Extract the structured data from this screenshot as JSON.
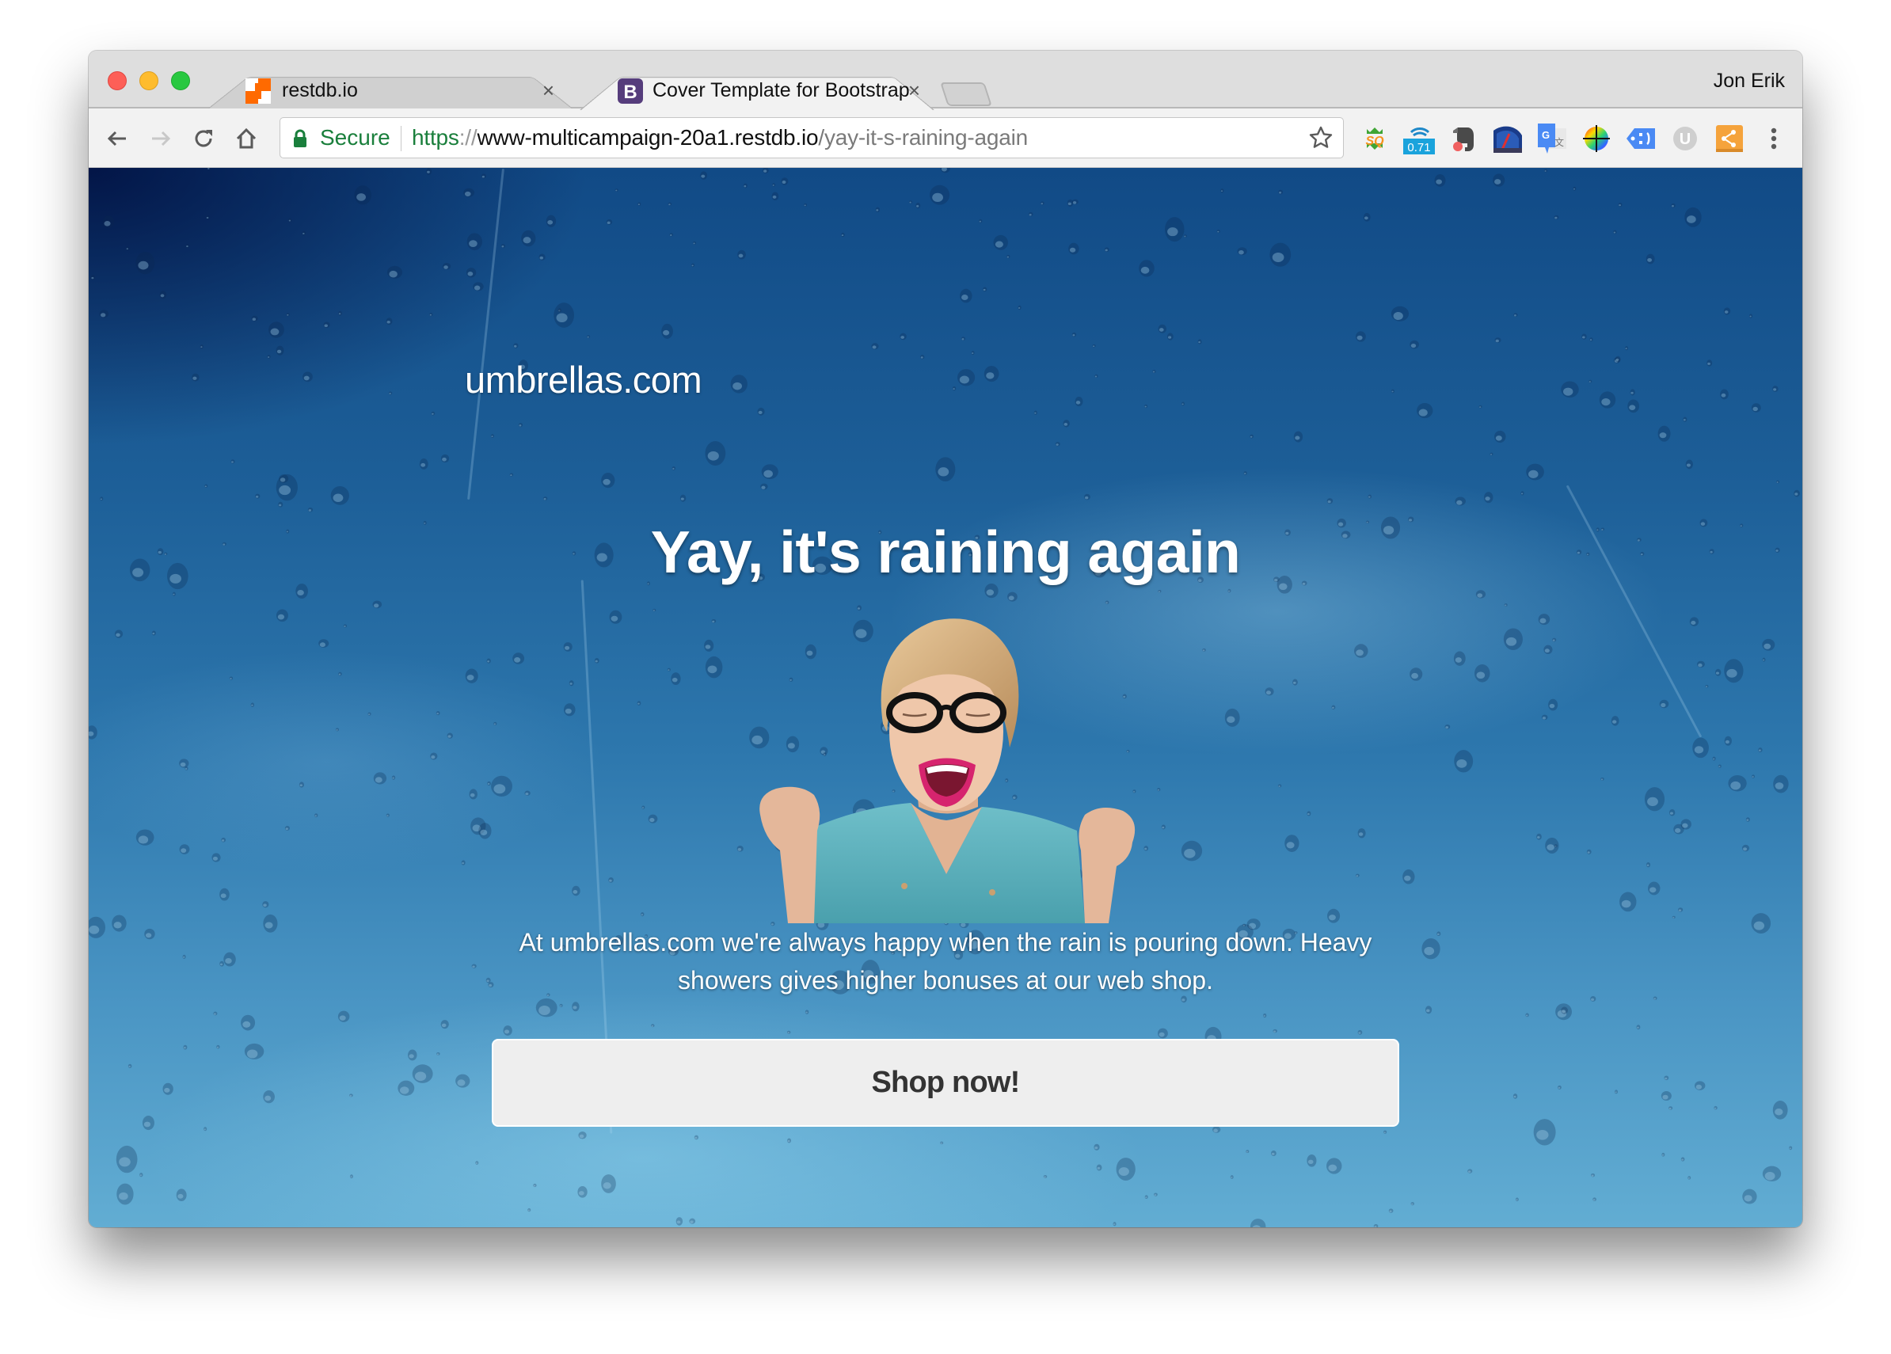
{
  "browser": {
    "tabs": [
      {
        "title": "restdb.io",
        "favicon": "restdb-icon",
        "active": false,
        "close_label": "×"
      },
      {
        "title": "Cover Template for Bootstrap",
        "favicon": "bootstrap-icon",
        "active": true,
        "close_label": "×"
      }
    ],
    "profile_name": "Jon Erik",
    "omnibox": {
      "security_label": "Secure",
      "url_scheme": "https",
      "url_separator": "://",
      "url_host": "www-multicampaign-20a1.restdb.io",
      "url_path": "/yay-it-s-raining-again"
    },
    "nav_icons": [
      "back-icon",
      "forward-icon",
      "reload-icon",
      "home-icon"
    ],
    "extensions": [
      {
        "name": "sq-extension-icon",
        "label": "SQ"
      },
      {
        "name": "rank-extension-icon",
        "badge": "0.71"
      },
      {
        "name": "evernote-icon"
      },
      {
        "name": "speedometer-icon"
      },
      {
        "name": "google-translate-icon",
        "label": "G"
      },
      {
        "name": "color-picker-icon"
      },
      {
        "name": "tag-icon"
      },
      {
        "name": "u-extension-icon",
        "label": "U"
      },
      {
        "name": "share-icon"
      },
      {
        "name": "menu-icon"
      }
    ],
    "colors": {
      "secure_green": "#1a7f3c",
      "bootstrap_purple": "#563d7c",
      "restdb_orange": "#ff6a00"
    }
  },
  "page": {
    "brand": "umbrellas.com",
    "headline": "Yay, it's raining again",
    "lead": "At umbrellas.com we're always happy when the rain is pouring down. Heavy showers gives higher bonuses at our web shop.",
    "cta_label": "Shop now!",
    "hero_image": "excited-woman-photo"
  }
}
